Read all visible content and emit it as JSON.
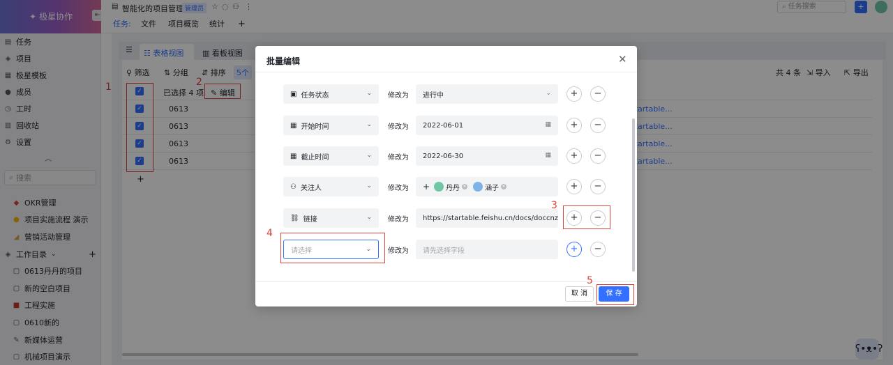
{
  "app": {
    "brand": "极星协作",
    "collapse_icon": "collapse-icon"
  },
  "sidebar": {
    "items": [
      {
        "label": "任务",
        "icon": "task-icon"
      },
      {
        "label": "项目",
        "icon": "project-icon"
      },
      {
        "label": "极星模板",
        "icon": "template-icon"
      },
      {
        "label": "成员",
        "icon": "member-icon"
      },
      {
        "label": "工时",
        "icon": "clock-icon"
      },
      {
        "label": "回收站",
        "icon": "trash-icon"
      },
      {
        "label": "设置",
        "icon": "gear-icon"
      }
    ],
    "search_placeholder": "搜索",
    "favorites": [
      "OKR管理",
      "项目实施流程 演示",
      "营销活动管理"
    ],
    "section": "工作目录",
    "dir_items": [
      "0613丹丹的项目",
      "新的空白项目",
      "工程实施",
      "0610新的",
      "新媒体运营",
      "机械项目演示"
    ]
  },
  "header": {
    "title": "智能化的项目管理",
    "badge": "管理员",
    "search_placeholder": "任务搜索",
    "add": "+"
  },
  "tabs": {
    "prefix": "任务:",
    "items": [
      "文件",
      "项目概览",
      "统计",
      "+"
    ]
  },
  "views": {
    "table": "表格视图",
    "kanban": "看板视图"
  },
  "toolbar": {
    "filter": "筛选",
    "group": "分组",
    "sort": "排序",
    "count_tag": "5个",
    "total": "共 4 条",
    "import": "导入",
    "export": "导出"
  },
  "table": {
    "selected": "已选择 4 项",
    "edit": "编辑",
    "rows": [
      "0613",
      "0613",
      "0613",
      "0613"
    ],
    "link_text": "startable...",
    "add_row": "+"
  },
  "annotations": [
    "1",
    "2",
    "3",
    "4",
    "5"
  ],
  "modal": {
    "title": "批量编辑",
    "modify_label": "修改为",
    "rows": [
      {
        "field": "任务状态",
        "icon": "status-icon",
        "value": "进行中",
        "tail": "chevron-down-icon"
      },
      {
        "field": "开始时间",
        "icon": "calendar-icon",
        "value": "2022-06-01",
        "tail": "calendar-icon"
      },
      {
        "field": "截止时间",
        "icon": "calendar-icon",
        "value": "2022-06-30",
        "tail": "calendar-icon"
      },
      {
        "field": "关注人",
        "icon": "people-icon",
        "value": "",
        "tail": ""
      },
      {
        "field": "链接",
        "icon": "link-icon",
        "value": "https://startable.feishu.cn/docs/doccnztkl",
        "tail": ""
      },
      {
        "field": "",
        "icon": "",
        "value": "",
        "tail": ""
      }
    ],
    "followers": [
      "丹丹",
      "涵子"
    ],
    "select_placeholder": "请选择",
    "value_placeholder": "请先选择字段",
    "cancel": "取 消",
    "save": "保 存"
  }
}
